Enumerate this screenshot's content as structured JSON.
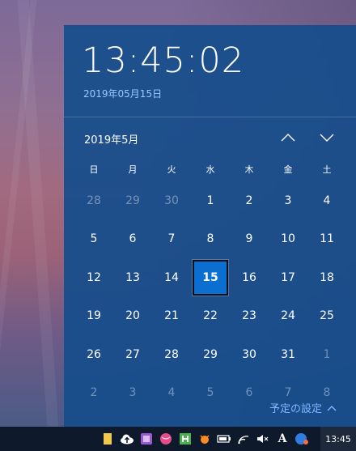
{
  "clock": {
    "time": "13:45:02",
    "date": "2019年05月15日"
  },
  "calendar": {
    "month_title": "2019年5月",
    "weekdays": [
      "日",
      "月",
      "火",
      "水",
      "木",
      "金",
      "土"
    ],
    "weeks": [
      [
        {
          "d": "28",
          "o": true
        },
        {
          "d": "29",
          "o": true
        },
        {
          "d": "30",
          "o": true
        },
        {
          "d": "1"
        },
        {
          "d": "2"
        },
        {
          "d": "3"
        },
        {
          "d": "4"
        }
      ],
      [
        {
          "d": "5"
        },
        {
          "d": "6"
        },
        {
          "d": "7"
        },
        {
          "d": "8"
        },
        {
          "d": "9"
        },
        {
          "d": "10"
        },
        {
          "d": "11"
        }
      ],
      [
        {
          "d": "12"
        },
        {
          "d": "13"
        },
        {
          "d": "14"
        },
        {
          "d": "15",
          "today": true
        },
        {
          "d": "16"
        },
        {
          "d": "17"
        },
        {
          "d": "18"
        }
      ],
      [
        {
          "d": "19"
        },
        {
          "d": "20"
        },
        {
          "d": "21"
        },
        {
          "d": "22"
        },
        {
          "d": "23"
        },
        {
          "d": "24"
        },
        {
          "d": "25"
        }
      ],
      [
        {
          "d": "26"
        },
        {
          "d": "27"
        },
        {
          "d": "28"
        },
        {
          "d": "29"
        },
        {
          "d": "30"
        },
        {
          "d": "31"
        },
        {
          "d": "1",
          "o": true
        }
      ],
      [
        {
          "d": "2",
          "o": true
        },
        {
          "d": "3",
          "o": true
        },
        {
          "d": "4",
          "o": true
        },
        {
          "d": "5",
          "o": true
        },
        {
          "d": "6",
          "o": true
        },
        {
          "d": "7",
          "o": true
        },
        {
          "d": "8",
          "o": true
        }
      ]
    ]
  },
  "agenda": {
    "label": "予定の設定"
  },
  "taskbar": {
    "clock": "13:45",
    "tray_icons": [
      "file-icon",
      "cloud-upload-icon",
      "app-icon",
      "ball-icon",
      "h-icon",
      "bug-icon",
      "battery-icon",
      "wifi-icon",
      "speaker-muted-icon",
      "ime-icon",
      "round-app-icon"
    ],
    "ime_label": "A"
  },
  "colors": {
    "flyout_bg": "#164e8c",
    "accent": "#0a6fd0",
    "link": "#7fb8ff",
    "date_text": "#9cc9ff"
  }
}
